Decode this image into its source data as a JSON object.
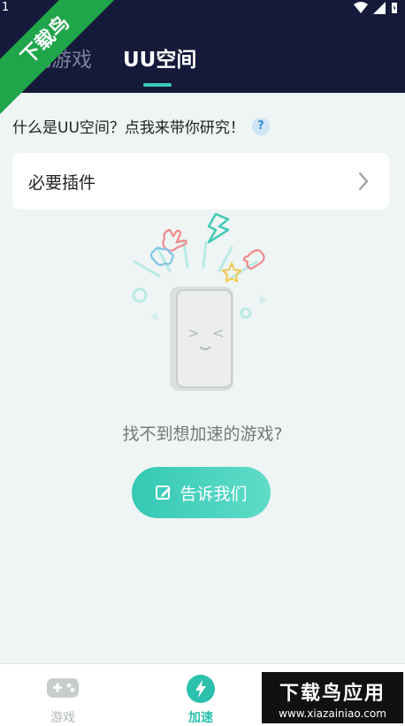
{
  "status": {
    "time": "1"
  },
  "tabs": [
    {
      "label": "本地游戏",
      "active": false
    },
    {
      "label": "UU空间",
      "active": true
    }
  ],
  "watermark": {
    "ribbon": "下载鸟",
    "brand": "下载鸟应用",
    "url": "www.xiazainiao.com"
  },
  "intro": {
    "text": "什么是UU空间？点我来带你研究！",
    "help_icon": "?"
  },
  "plugin_card": {
    "label": "必要插件"
  },
  "empty_state": {
    "text": "找不到想加速的游戏?"
  },
  "feedback_button": {
    "label": "告诉我们"
  },
  "bottom_nav": [
    {
      "label": "游戏",
      "icon": "gamepad-icon",
      "active": false
    },
    {
      "label": "加速",
      "icon": "lightning-icon",
      "active": true
    }
  ],
  "colors": {
    "header": "#161a3a",
    "accent": "#39cbb6",
    "background": "#eff4f4"
  }
}
